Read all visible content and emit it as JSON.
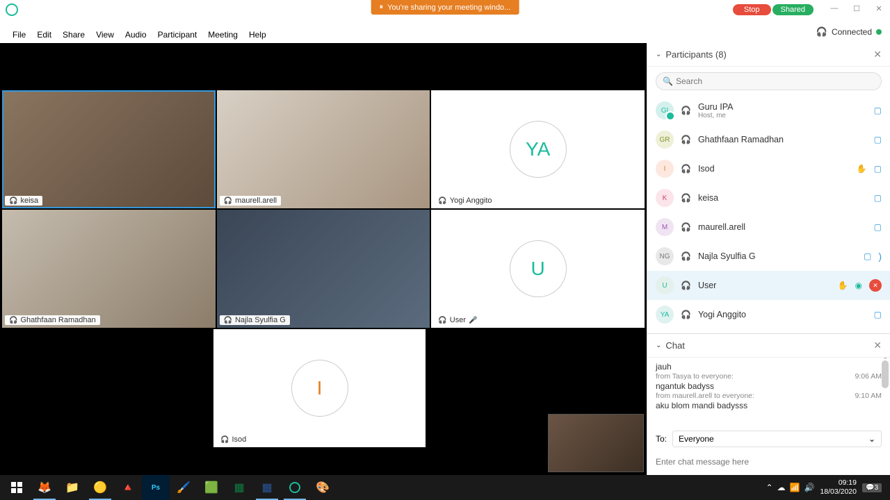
{
  "sharing": {
    "message": "You're sharing your meeting windo...",
    "stop": "Stop",
    "shared": "Shared"
  },
  "menu": {
    "file": "File",
    "edit": "Edit",
    "share": "Share",
    "view": "View",
    "audio": "Audio",
    "participant": "Participant",
    "meeting": "Meeting",
    "help": "Help"
  },
  "status": {
    "connected": "Connected"
  },
  "tiles": [
    {
      "name": "keisa"
    },
    {
      "name": "maurell.arell"
    },
    {
      "name": "Yogi Anggito",
      "initials": "YA"
    },
    {
      "name": "Ghathfaan Ramadhan"
    },
    {
      "name": "Najla Syulfia G"
    },
    {
      "name": "User",
      "initials": "U",
      "muted": true
    },
    {
      "name": "Isod",
      "initials": "I"
    }
  ],
  "participants": {
    "title": "Participants (8)",
    "search_placeholder": "Search",
    "list": [
      {
        "initials": "GI",
        "name": "Guru IPA",
        "sub": "Host, me",
        "cls": "pa-gi",
        "cam": true
      },
      {
        "initials": "GR",
        "name": "Ghathfaan Ramadhan",
        "cls": "pa-gr",
        "cam": true
      },
      {
        "initials": "I",
        "name": "Isod",
        "cls": "pa-i",
        "hand": true,
        "cam": true
      },
      {
        "initials": "K",
        "name": "keisa",
        "cls": "pa-k",
        "cam": true
      },
      {
        "initials": "M",
        "name": "maurell.arell",
        "cls": "pa-m",
        "cam": true
      },
      {
        "initials": "NG",
        "name": "Najla Syulfia G",
        "cls": "pa-ng",
        "cam": true,
        "extra": ")"
      },
      {
        "initials": "U",
        "name": "User",
        "cls": "pa-u",
        "hand": true,
        "sharing": true,
        "muted": true,
        "sel": true
      },
      {
        "initials": "YA",
        "name": "Yogi Anggito",
        "cls": "pa-ya",
        "cam": true
      }
    ]
  },
  "chat": {
    "title": "Chat",
    "messages": [
      {
        "text": "jauh"
      },
      {
        "meta": "from Tasya to everyone:",
        "time": "9:06 AM"
      },
      {
        "text": "ngantuk badyss"
      },
      {
        "meta": "from maurell.arell to everyone:",
        "time": "9:10 AM"
      },
      {
        "text": "aku blom mandi badysss"
      }
    ],
    "to_label": "To:",
    "to_value": "Everyone",
    "placeholder": "Enter chat message here"
  },
  "taskbar": {
    "time": "09:19",
    "date": "18/03/2020",
    "notif": "3"
  }
}
